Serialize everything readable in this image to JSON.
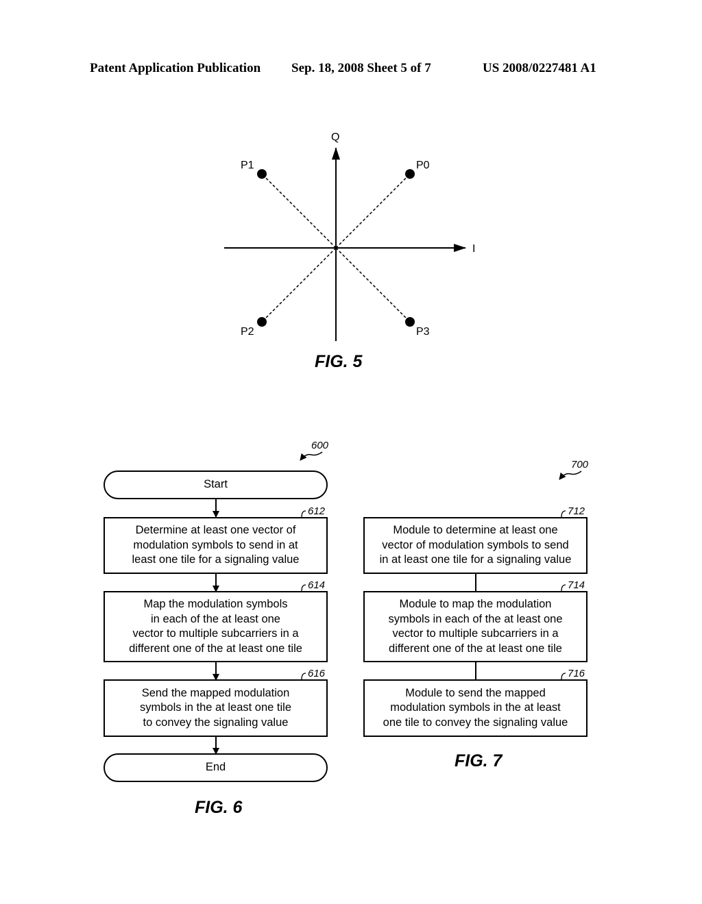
{
  "header": {
    "left": "Patent Application Publication",
    "middle": "Sep. 18, 2008   Sheet 5 of 7",
    "right": "US 2008/0227481 A1"
  },
  "fig5": {
    "caption": "FIG. 5",
    "axis_q": "Q",
    "axis_i": "I",
    "points": [
      {
        "label": "P0",
        "i": 1,
        "q": 1
      },
      {
        "label": "P1",
        "i": -1,
        "q": 1
      },
      {
        "label": "P2",
        "i": -1,
        "q": -1
      },
      {
        "label": "P3",
        "i": 1,
        "q": -1
      }
    ]
  },
  "fig6": {
    "caption": "FIG. 6",
    "ref": "600",
    "start": "Start",
    "end": "End",
    "steps": [
      {
        "ref": "612",
        "lines": [
          "Determine at least one vector of",
          "modulation symbols to send in at",
          "least one tile for a signaling value"
        ]
      },
      {
        "ref": "614",
        "lines": [
          "Map the modulation symbols",
          "in each of the at least one",
          "vector to multiple subcarriers in a",
          "different one of the at least one tile"
        ]
      },
      {
        "ref": "616",
        "lines": [
          "Send the mapped modulation",
          "symbols in the at least one tile",
          "to convey the signaling value"
        ]
      }
    ]
  },
  "fig7": {
    "caption": "FIG. 7",
    "ref": "700",
    "modules": [
      {
        "ref": "712",
        "lines": [
          "Module to determine at least one",
          "vector of modulation symbols to send",
          "in at least one tile for a signaling value"
        ]
      },
      {
        "ref": "714",
        "lines": [
          "Module to map the modulation",
          "symbols in each of the at least one",
          "vector to multiple subcarriers in a",
          "different one of the at least one tile"
        ]
      },
      {
        "ref": "716",
        "lines": [
          "Module to send the mapped",
          "modulation symbols in the at least",
          "one tile to convey the signaling value"
        ]
      }
    ]
  }
}
